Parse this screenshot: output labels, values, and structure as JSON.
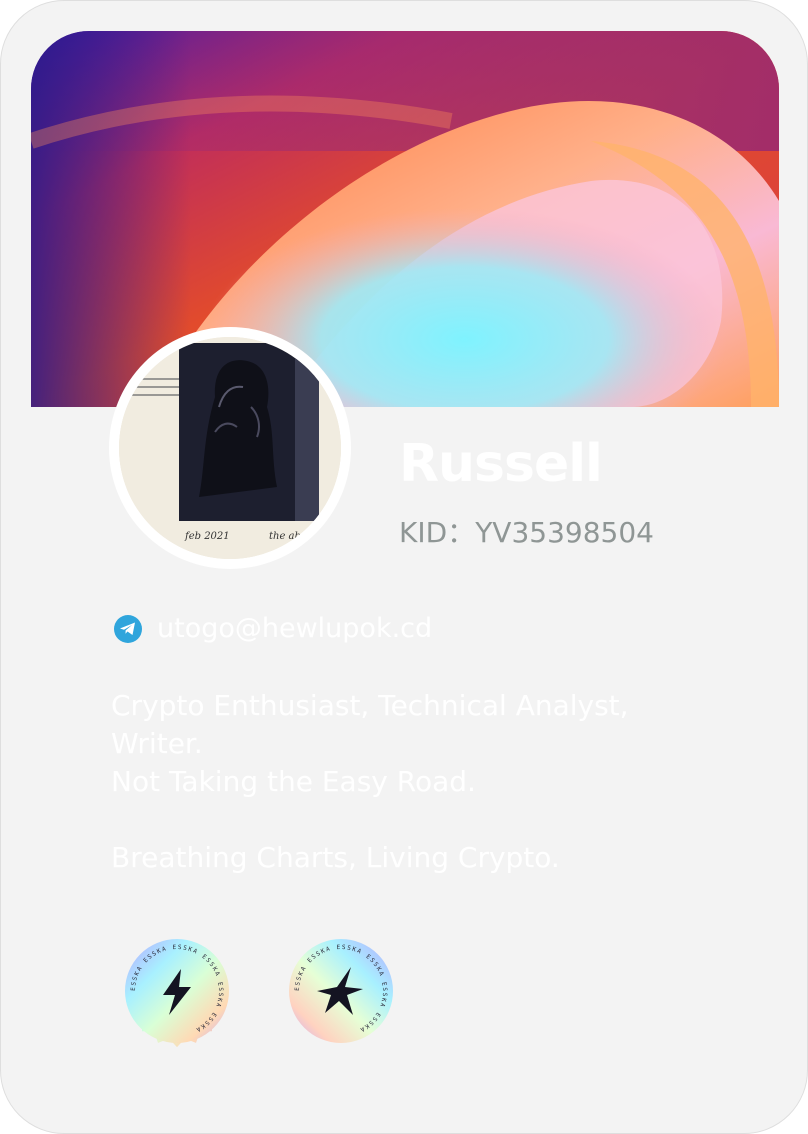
{
  "profile": {
    "name": "Russell",
    "kid_label": "KID：",
    "kid_value": "YV35398504",
    "email": "utogo@hewlupok.cd",
    "avatar_caption_left": "feb 2021",
    "avatar_caption_right": "the abyss"
  },
  "bio": {
    "line1": "Crypto Enthusiast, Technical Analyst,",
    "line2": "Writer.",
    "line3": "Not Taking the Easy Road.",
    "line4": "",
    "line5": "Breathing Charts, Living Crypto."
  },
  "badges": {
    "badge1": {
      "icon": "lightning-bolt-icon",
      "ring_text": "ESSKA ESSKA ESSKA ESSKA ESSKA ESSKA"
    },
    "badge2": {
      "icon": "star-lightning-icon",
      "ring_text": "ESSKA ESSKA ESSKA ESSKA ESSKA ESSKA"
    }
  },
  "colors": {
    "card_background": "#f3f3f3",
    "kid_text": "#8f9695",
    "telegram_blue": "#2fa5dc",
    "primary_text": "#ffffff"
  }
}
